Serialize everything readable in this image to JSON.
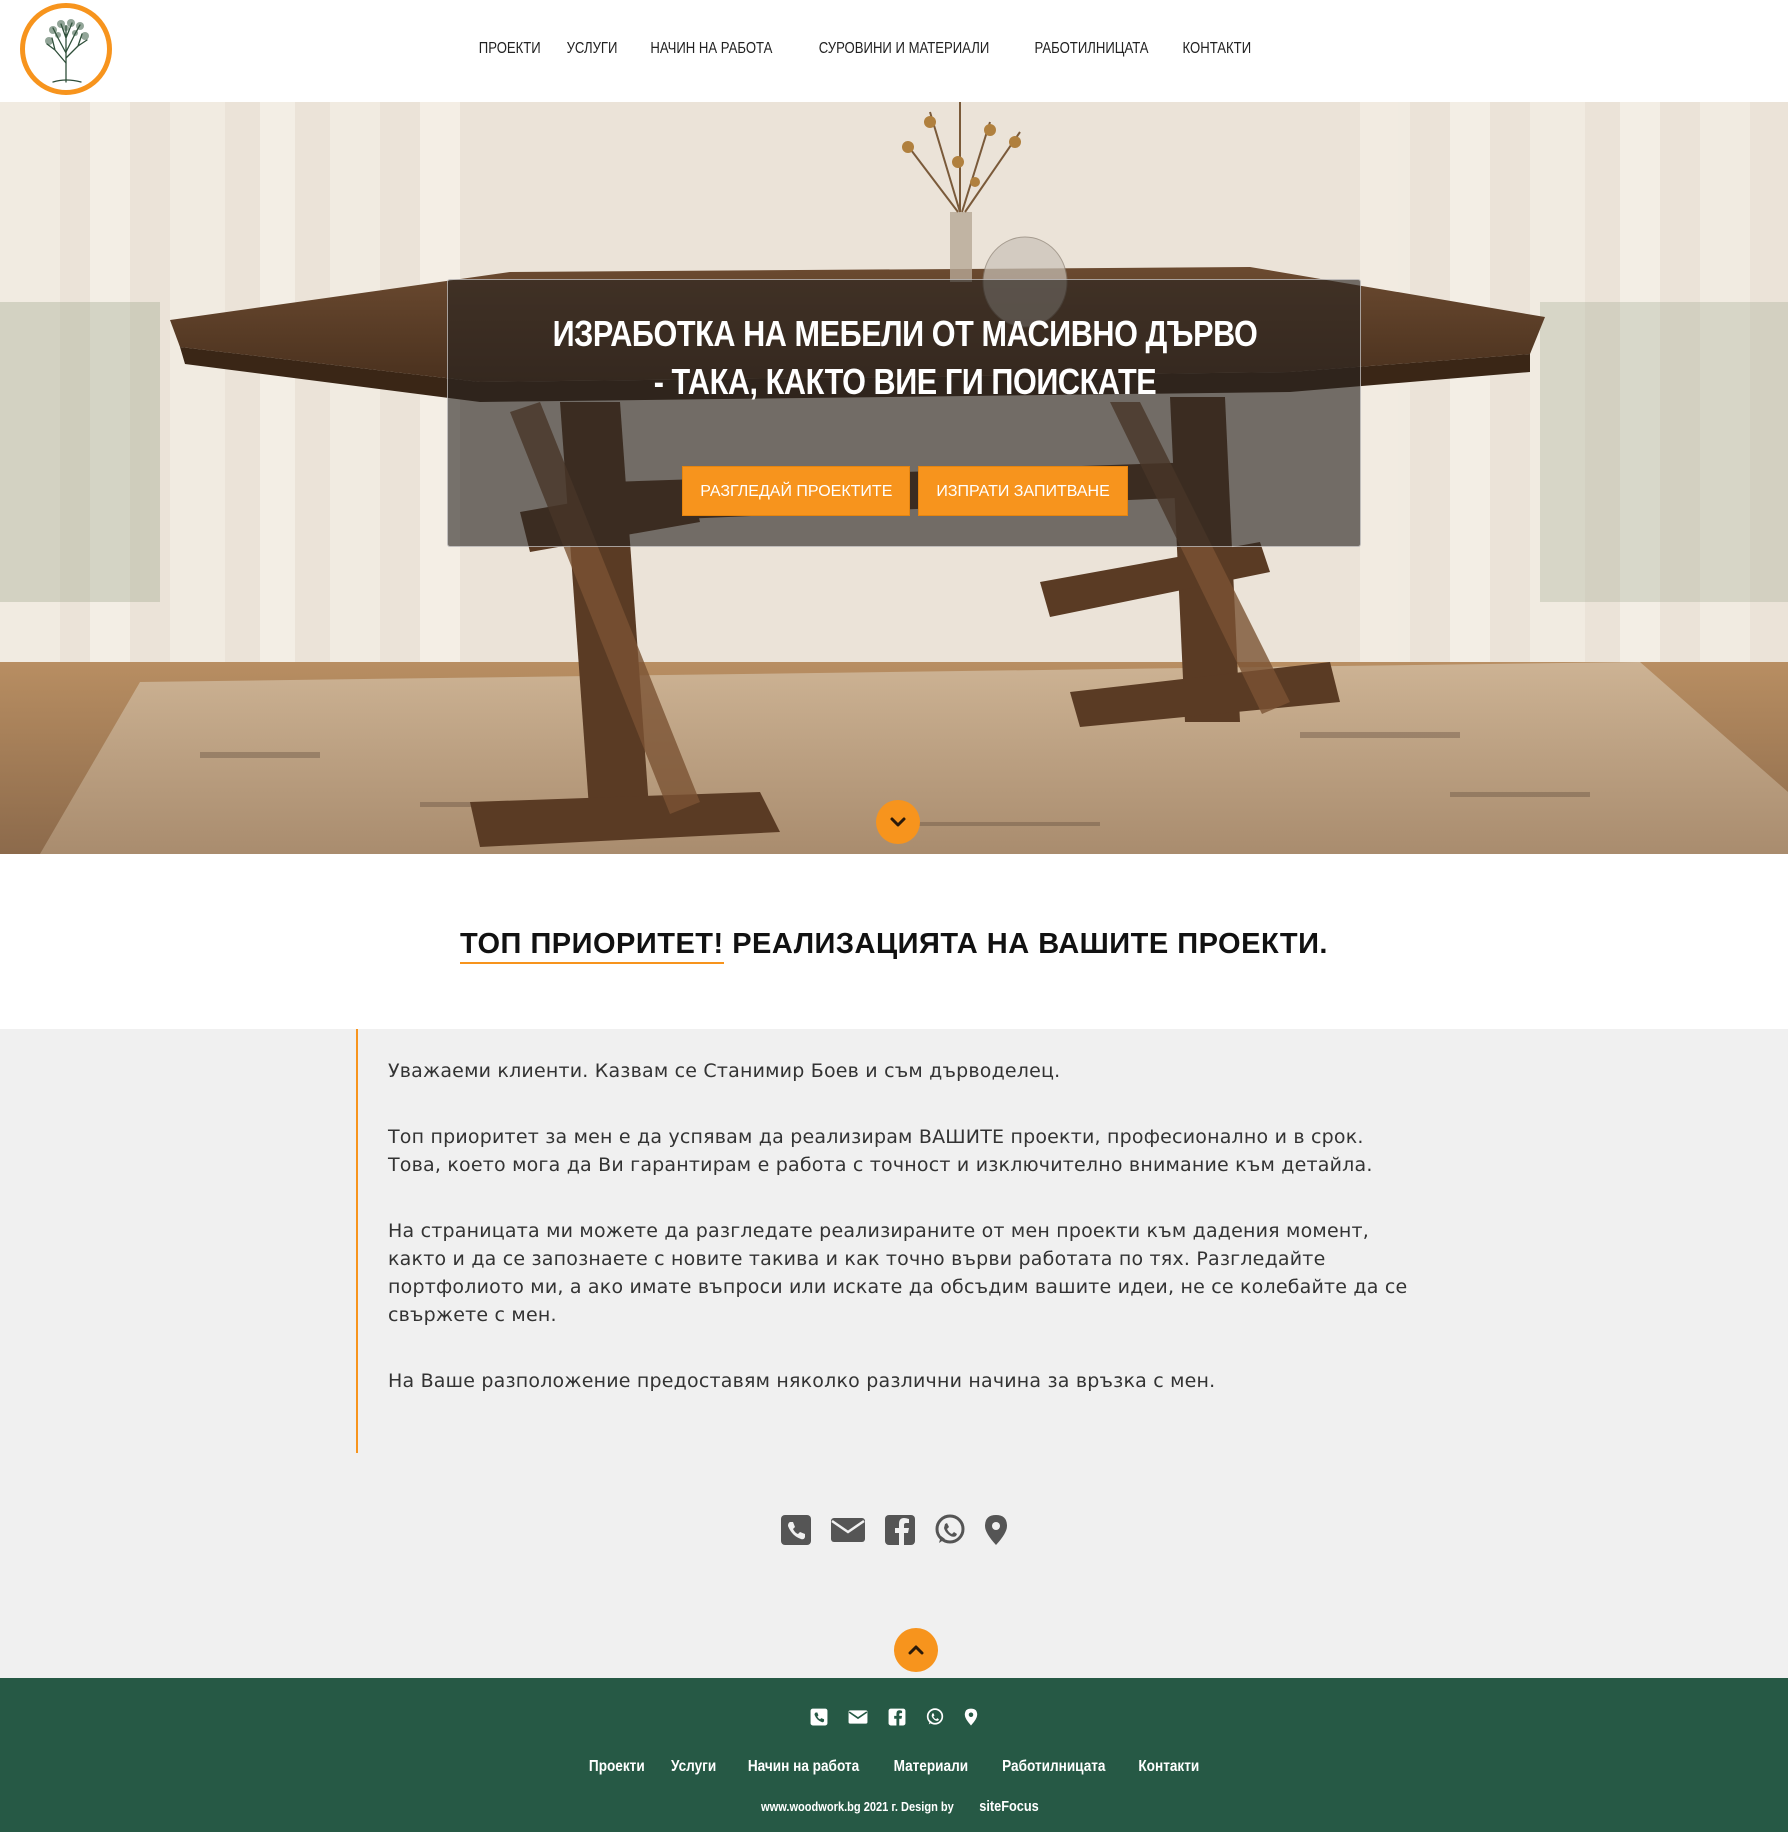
{
  "nav": {
    "items": [
      "ПРОЕКТИ",
      "УСЛУГИ",
      "НАЧИН НА РАБОТА",
      "СУРОВИНИ И МАТЕРИАЛИ",
      "РАБОТИЛНИЦАТА",
      "КОНТАКТИ"
    ]
  },
  "hero": {
    "title": "ИЗРАБОТКА НА МЕБЕЛИ ОТ МАСИВНО ДЪРВО - ТАКА, КАКТО ВИЕ ГИ ПОИСКАТЕ",
    "btn_projects": "РАЗГЛЕДАЙ ПРОЕКТИТЕ",
    "btn_inquiry": "ИЗПРАТИ ЗАПИТВАНЕ"
  },
  "headline": {
    "highlight": "ТОП ПРИОРИТЕТ!",
    "rest": " РЕАЛИЗАЦИЯТА НА ВАШИТЕ ПРОЕКТИ."
  },
  "content": {
    "paragraphs": [
      "Уважаеми клиенти. Казвам се Станимир Боев и съм дърводелец.",
      "Топ приоритет за мен е да успявам да реализирам ВАШИТЕ проекти, професионално и в срок. Това, което мога да Ви гарантирам е работа с точност и изключително внимание към детайла.",
      "На страницата ми можете да разгледате реализираните от мен проекти към дадения момент, както и да се запознаете с новите такива и как точно върви работата по тях. Разгледайте портфолиото ми, а ако имате въпроси или искате да обсъдим вашите идеи, не се колебайте да се свържете с мен.",
      "На Ваше разположение предоставям няколко различни начина за връзка с мен."
    ],
    "contact_icons": [
      "phone-icon",
      "envelope-icon",
      "facebook-icon",
      "whatsapp-icon",
      "map-marker-icon"
    ]
  },
  "footer": {
    "links": [
      "Проекти",
      "Услуги",
      "Начин на работа",
      "Материали",
      "Работилницата",
      "Контакти"
    ],
    "copyright": "www.woodwork.bg 2021 г. Design by",
    "brand": "siteFocus"
  },
  "colors": {
    "accent": "#f7941d",
    "footer_bg": "#265945",
    "content_bg": "#f0f0f0",
    "icon_grey": "#555555"
  }
}
